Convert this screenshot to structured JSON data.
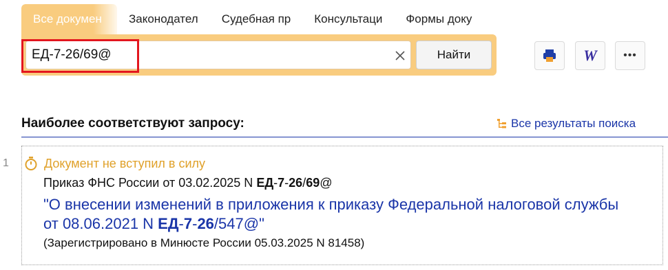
{
  "tabs": [
    {
      "label": "Все докумен"
    },
    {
      "label": "Законодател"
    },
    {
      "label": "Судебная пр"
    },
    {
      "label": "Консультаци"
    },
    {
      "label": "Формы доку"
    }
  ],
  "search": {
    "value": "ЕД-7-26/69@",
    "find_label": "Найти"
  },
  "toolbar_icons": [
    "print-icon",
    "word-export-icon",
    "more-icon"
  ],
  "toolbar": {
    "word_letter": "W",
    "more_glyph": "•••"
  },
  "section_title": "Наиболее соответствуют запросу:",
  "all_results_link": "Все результаты поиска",
  "results": [
    {
      "number": "1",
      "status": "Документ не вступил в силу",
      "line_pre": "Приказ ФНС России от 03.02.2025 N ",
      "line_code_a": "ЕД",
      "line_code_b": "7",
      "line_code_c": "26",
      "line_code_d": "69",
      "line_code_tail": "@",
      "title_pre": "\"О внесении изменений в приложения к приказу Федеральной налоговой службы от 08.06.2021 N ",
      "title_code_a": "ЕД",
      "title_code_b": "7",
      "title_code_c": "26",
      "title_code_tail": "/547@\"",
      "note": "(Зарегистрировано в Минюсте России 05.03.2025 N 81458)"
    }
  ],
  "colors": {
    "accent": "#f9cc7f",
    "link": "#1a35a8",
    "status": "#e0a12a",
    "highlight": "#e3161e"
  }
}
